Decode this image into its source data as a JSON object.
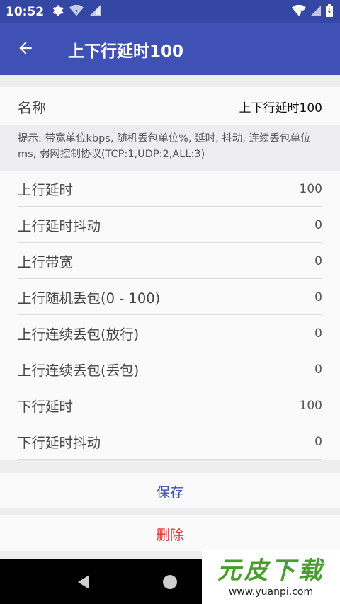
{
  "status_bar": {
    "time": "10:52"
  },
  "app_bar": {
    "title": "上下行延时100"
  },
  "form": {
    "name_label": "名称",
    "name_value": "上下行延时100",
    "hint": "提示: 带宽单位kbps, 随机丢包单位%, 延时, 抖动, 连续丢包单位ms, 弱网控制协议(TCP:1,UDP:2,ALL:3)",
    "rows": [
      {
        "label": "上行延时",
        "value": "100"
      },
      {
        "label": "上行延时抖动",
        "value": "0"
      },
      {
        "label": "上行带宽",
        "value": "0"
      },
      {
        "label": "上行随机丢包(0 - 100)",
        "value": "0"
      },
      {
        "label": "上行连续丢包(放行)",
        "value": "0"
      },
      {
        "label": "上行连续丢包(丢包)",
        "value": "0"
      },
      {
        "label": "下行延时",
        "value": "100"
      },
      {
        "label": "下行延时抖动",
        "value": "0"
      }
    ]
  },
  "actions": {
    "save_label": "保存",
    "delete_label": "删除"
  },
  "watermark": {
    "title": "元皮下载",
    "url": "www.yuanpi.com"
  },
  "colors": {
    "primary": "#3f51b5",
    "status_bar": "#3547a5",
    "delete": "#e53935"
  }
}
